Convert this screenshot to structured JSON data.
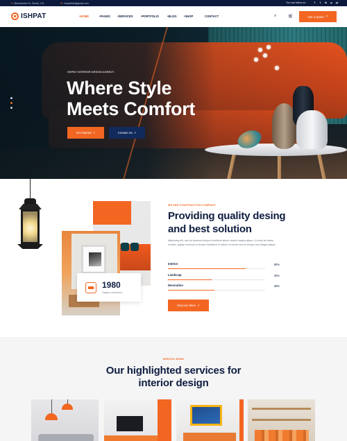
{
  "topbar": {
    "address": "Manchester 21, Zurich, CH",
    "email": "ishpatinfo@gmail.com",
    "follow_label": "You can follow us :",
    "socials": [
      "f",
      "t",
      "in",
      "p",
      "yt"
    ]
  },
  "header": {
    "logo_text": "ISHPAT",
    "nav": [
      "•HOME",
      "•PAGES",
      "•SERVICES",
      "•PORTFOLIO",
      "•BLOG",
      "•SHOP",
      "CONTACT"
    ],
    "quote_button": "Get a Quote"
  },
  "hero": {
    "eyebrow": "ISHPAT INTERIOR DESIGN AGENCY",
    "title": "Where Style Meets Comfort",
    "primary_button": "Get Started",
    "secondary_button": "Contact Us",
    "slide_count": 3,
    "active_slide": 2
  },
  "about": {
    "eyebrow": "WE ARE CONSTRUCTION COMPANY",
    "title": "Providing quality desing and best solution",
    "description": "Adipiscing elit, sed do eiusmod tempor incididunt labore dolore magna aliqua. Ut enim ad minim veniam, quisqu eiusmod ut tempor incididunt ut labore et dolore sed do tempor has Magna aliqua.",
    "stat": {
      "number": "1980",
      "label": "Happy customers"
    },
    "skills": [
      {
        "name": "Interior",
        "percent_label": "80%",
        "value": 80
      },
      {
        "name": "Landscap",
        "percent_label": "45%",
        "value": 45
      },
      {
        "name": "Decoration",
        "percent_label": "48%",
        "value": 48
      }
    ],
    "button": "Discover More"
  },
  "services": {
    "eyebrow": "SERVICE WORK",
    "title": "Our highlighted services for interior design"
  },
  "colors": {
    "accent": "#f26622",
    "navy": "#0e1d3f",
    "topbar": "#0b1a3c",
    "secondary_button": "#112a5c"
  },
  "icons": {
    "topbar_address": "location-pin-icon",
    "topbar_email": "envelope-icon",
    "search": "search-icon",
    "cart": "cart-icon",
    "arrow": "arrow-up-right-icon"
  }
}
